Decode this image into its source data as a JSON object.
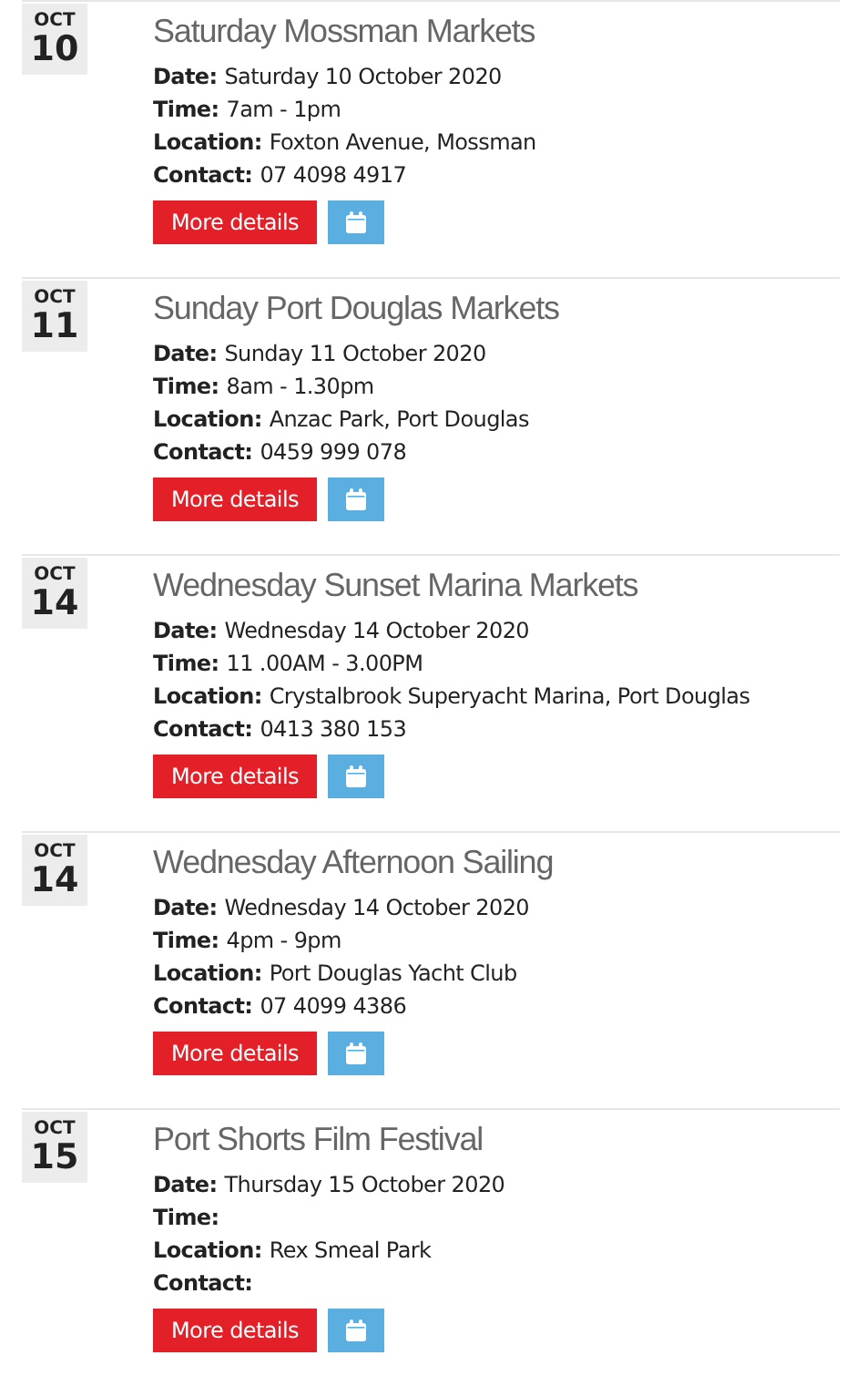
{
  "events": [
    {
      "month": "OCT",
      "day": "10",
      "title": "Saturday Mossman Markets",
      "fields": [
        {
          "label": "Date:",
          "value": "Saturday 10 October 2020"
        },
        {
          "label": "Time:",
          "value": "7am - 1pm"
        },
        {
          "label": "Location:",
          "value": "Foxton Avenue, Mossman"
        },
        {
          "label": "Contact:",
          "value": "07 4098 4917"
        }
      ],
      "button": "More details"
    },
    {
      "month": "OCT",
      "day": "11",
      "title": "Sunday Port Douglas Markets",
      "fields": [
        {
          "label": "Date:",
          "value": "Sunday 11 October 2020"
        },
        {
          "label": "Time:",
          "value": "8am - 1.30pm"
        },
        {
          "label": "Location:",
          "value": "Anzac Park, Port Douglas"
        },
        {
          "label": "Contact:",
          "value": "0459 999 078"
        }
      ],
      "button": "More details"
    },
    {
      "month": "OCT",
      "day": "14",
      "title": "Wednesday Sunset Marina Markets",
      "fields": [
        {
          "label": "Date:",
          "value": "Wednesday 14 October 2020"
        },
        {
          "label": "Time:",
          "value": "11 .00AM - 3.00PM"
        },
        {
          "label": "Location:",
          "value": "Crystalbrook Superyacht Marina, Port Douglas"
        },
        {
          "label": "Contact:",
          "value": "0413 380 153"
        }
      ],
      "button": "More details"
    },
    {
      "month": "OCT",
      "day": "14",
      "title": "Wednesday Afternoon Sailing",
      "fields": [
        {
          "label": "Date:",
          "value": "Wednesday 14 October 2020"
        },
        {
          "label": "Time:",
          "value": "4pm - 9pm"
        },
        {
          "label": "Location:",
          "value": "Port Douglas Yacht Club"
        },
        {
          "label": "Contact:",
          "value": "07 4099 4386"
        }
      ],
      "button": "More details"
    },
    {
      "month": "OCT",
      "day": "15",
      "title": "Port Shorts Film Festival",
      "fields": [
        {
          "label": "Date:",
          "value": "Thursday 15 October 2020"
        },
        {
          "label": "Time:"
        },
        {
          "label": "Location:",
          "value": "Rex Smeal Park"
        },
        {
          "label": "Contact:"
        }
      ],
      "button": "More details"
    }
  ]
}
